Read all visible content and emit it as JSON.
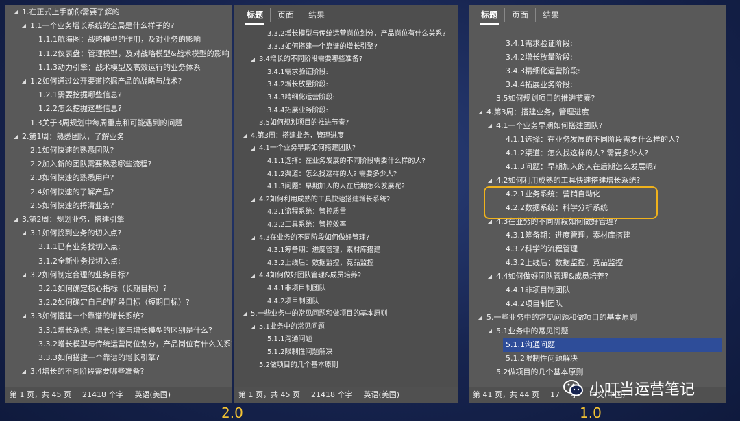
{
  "tabs": [
    "标题",
    "页面",
    "结果"
  ],
  "pane1": {
    "items": [
      {
        "l": 0,
        "e": 1,
        "t": "1.在正式上手前你需要了解的"
      },
      {
        "l": 1,
        "e": 1,
        "t": "1.1一个业务增长系统的全局是什么样子的?"
      },
      {
        "l": 2,
        "e": 0,
        "t": "1.1.1航海图：战略模型的作用，及对业务的影响"
      },
      {
        "l": 2,
        "e": 0,
        "t": "1.1.2仪表盘：管理模型，及对战略模型&战术模型的影响"
      },
      {
        "l": 2,
        "e": 0,
        "t": "1.1.3动力引擎：战术模型及高效运行的业务体系"
      },
      {
        "l": 1,
        "e": 1,
        "t": "1.2如何通过公开渠道挖掘产品的战略与战术?"
      },
      {
        "l": 2,
        "e": 0,
        "t": "1.2.1需要挖掘哪些信息?"
      },
      {
        "l": 2,
        "e": 0,
        "t": "1.2.2怎么挖掘这些信息?"
      },
      {
        "l": 1,
        "e": 0,
        "t": "1.3关于3周规划中每周重点和可能遇到的问题"
      },
      {
        "l": 0,
        "e": 1,
        "t": "2.第1周：熟悉团队，了解业务"
      },
      {
        "l": 1,
        "e": 0,
        "t": "2.1如何快速的熟悉团队?"
      },
      {
        "l": 1,
        "e": 0,
        "t": "2.2加入新的团队需要熟悉哪些流程?"
      },
      {
        "l": 1,
        "e": 0,
        "t": "2.3如何快速的熟悉用户?"
      },
      {
        "l": 1,
        "e": 0,
        "t": "2.4如何快速的了解产品?"
      },
      {
        "l": 1,
        "e": 0,
        "t": "2.5如何快速的捋清业务?"
      },
      {
        "l": 0,
        "e": 1,
        "t": "3.第2周：规划业务，搭建引擎"
      },
      {
        "l": 1,
        "e": 1,
        "t": "3.1如何找到业务的切入点?"
      },
      {
        "l": 2,
        "e": 0,
        "t": "3.1.1已有业务找切入点:"
      },
      {
        "l": 2,
        "e": 0,
        "t": "3.1.2全新业务找切入点:"
      },
      {
        "l": 1,
        "e": 1,
        "t": "3.2如何制定合理的业务目标?"
      },
      {
        "l": 2,
        "e": 0,
        "t": "3.2.1如何确定核心指标（长期目标）?"
      },
      {
        "l": 2,
        "e": 0,
        "t": "3.2.2如何确定自己的阶段目标（短期目标）?"
      },
      {
        "l": 1,
        "e": 1,
        "t": "3.3如何搭建一个靠谱的增长系统?"
      },
      {
        "l": 2,
        "e": 0,
        "t": "3.3.1增长系统，增长引擎与增长模型的区别是什么?"
      },
      {
        "l": 2,
        "e": 0,
        "t": "3.3.2增长模型与传统运营岗位划分，产品岗位有什么关系?"
      },
      {
        "l": 2,
        "e": 0,
        "t": "3.3.3如何搭建一个靠谱的增长引擎?"
      },
      {
        "l": 1,
        "e": 1,
        "t": "3.4增长的不同阶段需要哪些准备?"
      }
    ],
    "status": [
      "第 1 页，共 45 页",
      "21418 个字",
      "英语(美国)"
    ]
  },
  "pane2": {
    "items": [
      {
        "l": 2,
        "e": 0,
        "t": "3.3.2增长模型与传统运营岗位划分，产品岗位有什么关系?"
      },
      {
        "l": 2,
        "e": 0,
        "t": "3.3.3如何搭建一个靠谱的增长引擎?"
      },
      {
        "l": 1,
        "e": 1,
        "t": "3.4增长的不同阶段需要哪些准备?"
      },
      {
        "l": 2,
        "e": 0,
        "t": "3.4.1需求验证阶段:"
      },
      {
        "l": 2,
        "e": 0,
        "t": "3.4.2增长放量阶段:"
      },
      {
        "l": 2,
        "e": 0,
        "t": "3.4.3精细化运营阶段:"
      },
      {
        "l": 2,
        "e": 0,
        "t": "3.4.4拓展业务阶段:"
      },
      {
        "l": 1,
        "e": 0,
        "t": "3.5如何规划项目的推进节奏?"
      },
      {
        "l": 0,
        "e": 1,
        "t": "4.第3周：搭建业务，管理进度"
      },
      {
        "l": 1,
        "e": 1,
        "t": "4.1一个业务早期如何搭建团队?"
      },
      {
        "l": 2,
        "e": 0,
        "t": "4.1.1选择：在业务发展的不同阶段需要什么样的人?"
      },
      {
        "l": 2,
        "e": 0,
        "t": "4.1.2渠道：怎么找这样的人? 需要多少人?"
      },
      {
        "l": 2,
        "e": 0,
        "t": "4.1.3问题：早期加入的人在后期怎么发展呢?"
      },
      {
        "l": 1,
        "e": 1,
        "t": "4.2如何利用成熟的工具快速搭建增长系统?"
      },
      {
        "l": 2,
        "e": 0,
        "t": "4.2.1流程系统：管控质量"
      },
      {
        "l": 2,
        "e": 0,
        "t": "4.2.2工具系统：管控效率"
      },
      {
        "l": 1,
        "e": 1,
        "t": "4.3在业务的不同阶段如何做好管理?"
      },
      {
        "l": 2,
        "e": 0,
        "t": "4.3.1筹备期：进度管理，素材库搭建"
      },
      {
        "l": 2,
        "e": 0,
        "t": "4.3.2上线后：数据监控，竞品监控"
      },
      {
        "l": 1,
        "e": 1,
        "t": "4.4如何做好团队管理&成员培养?"
      },
      {
        "l": 2,
        "e": 0,
        "t": "4.4.1非项目制团队"
      },
      {
        "l": 2,
        "e": 0,
        "t": "4.4.2项目制团队"
      },
      {
        "l": 0,
        "e": 1,
        "t": "5.一些业务中的常见问题和做项目的基本原则"
      },
      {
        "l": 1,
        "e": 1,
        "t": "5.1业务中的常见问题"
      },
      {
        "l": 2,
        "e": 0,
        "t": "5.1.1沟通问题"
      },
      {
        "l": 2,
        "e": 0,
        "t": "5.1.2限制性问题解决"
      },
      {
        "l": 1,
        "e": 0,
        "t": "5.2做项目的几个基本原则"
      }
    ],
    "status": [
      "第 1 页，共 45 页",
      "21418 个字",
      "英语(美国)"
    ]
  },
  "pane3": {
    "items": [
      {
        "l": 2,
        "e": 0,
        "t": "3.4.1需求验证阶段:"
      },
      {
        "l": 2,
        "e": 0,
        "t": "3.4.2增长放量阶段:"
      },
      {
        "l": 2,
        "e": 0,
        "t": "3.4.3精细化运营阶段:"
      },
      {
        "l": 2,
        "e": 0,
        "t": "3.4.4拓展业务阶段:"
      },
      {
        "l": 1,
        "e": 0,
        "t": "3.5如何规划项目的推进节奏?"
      },
      {
        "l": 0,
        "e": 1,
        "t": "4.第3周：搭建业务，管理进度"
      },
      {
        "l": 1,
        "e": 1,
        "t": "4.1一个业务早期如何搭建团队?"
      },
      {
        "l": 2,
        "e": 0,
        "t": "4.1.1选择：在业务发展的不同阶段需要什么样的人?"
      },
      {
        "l": 2,
        "e": 0,
        "t": "4.1.2渠道：怎么找这样的人? 需要多少人?"
      },
      {
        "l": 2,
        "e": 0,
        "t": "4.1.3问题：早期加入的人在后期怎么发展呢?"
      },
      {
        "l": 1,
        "e": 1,
        "t": "4.2如何利用成熟的工具快速搭建增长系统?"
      },
      {
        "l": 2,
        "e": 0,
        "t": "4.2.1业务系统：营销自动化"
      },
      {
        "l": 2,
        "e": 0,
        "t": "4.2.2数据系统：科学分析系统"
      },
      {
        "l": 1,
        "e": 1,
        "t": "4.3在业务的不同阶段如何做好管理?"
      },
      {
        "l": 2,
        "e": 0,
        "t": "4.3.1筹备期：进度管理，素材库搭建"
      },
      {
        "l": 2,
        "e": 0,
        "t": "4.3.2科学的流程管理"
      },
      {
        "l": 2,
        "e": 0,
        "t": "4.3.2上线后：数据监控，竞品监控"
      },
      {
        "l": 1,
        "e": 1,
        "t": "4.4如何做好团队管理&成员培养?"
      },
      {
        "l": 2,
        "e": 0,
        "t": "4.4.1非项目制团队"
      },
      {
        "l": 2,
        "e": 0,
        "t": "4.4.2项目制团队"
      },
      {
        "l": 0,
        "e": 1,
        "t": "5.一些业务中的常见问题和做项目的基本原则"
      },
      {
        "l": 1,
        "e": 1,
        "t": "5.1业务中的常见问题"
      },
      {
        "l": 2,
        "e": 0,
        "t": "5.1.1沟通问题",
        "sel": 1
      },
      {
        "l": 2,
        "e": 0,
        "t": "5.1.2限制性问题解决"
      },
      {
        "l": 1,
        "e": 0,
        "t": "5.2做项目的几个基本原则"
      }
    ],
    "status": [
      "第 41 页，共 44 页",
      "17",
      "字",
      "中文(中国)"
    ]
  },
  "versions": {
    "left": "2.0",
    "right": "1.0"
  },
  "watermark": {
    "text": "小叮当运营笔记",
    "icon": "wechat-icon"
  }
}
